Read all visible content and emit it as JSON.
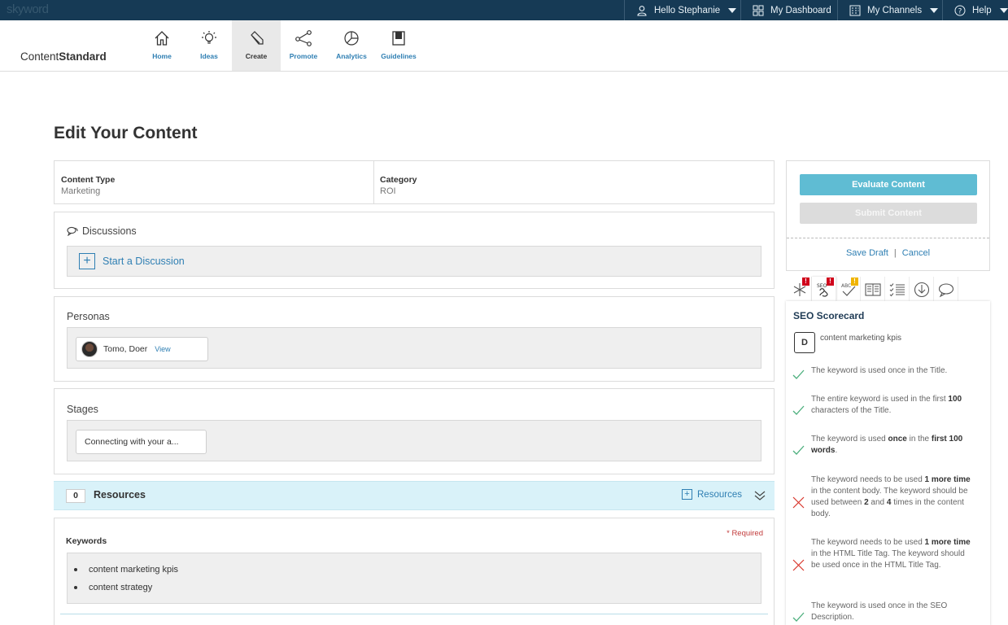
{
  "topbar": {
    "logo": "skyword",
    "user": "Hello Stephanie",
    "dashboard": "My Dashboard",
    "channels": "My Channels",
    "help": "Help"
  },
  "brand": {
    "prefix": "Content",
    "suffix": "Standard"
  },
  "nav": [
    {
      "label": "Home",
      "icon": "home-icon"
    },
    {
      "label": "Ideas",
      "icon": "lightbulb-icon"
    },
    {
      "label": "Create",
      "icon": "pencil-icon",
      "active": true
    },
    {
      "label": "Promote",
      "icon": "share-icon"
    },
    {
      "label": "Analytics",
      "icon": "pie-chart-icon"
    },
    {
      "label": "Guidelines",
      "icon": "book-icon"
    }
  ],
  "page": {
    "title": "Edit Your Content"
  },
  "content_info": {
    "type_label": "Content Type",
    "type_value": "Marketing",
    "category_label": "Category",
    "category_value": "ROI"
  },
  "discussions": {
    "title": "Discussions",
    "start_label": "Start a Discussion"
  },
  "personas": {
    "title": "Personas",
    "name": "Tomo, Doer",
    "view_label": "View"
  },
  "stages": {
    "title": "Stages",
    "value": "Connecting with your a..."
  },
  "resources": {
    "count": "0",
    "label": "Resources",
    "link_label": "Resources"
  },
  "keywords": {
    "title": "Keywords",
    "required": "* Required",
    "items": [
      "content marketing kpis",
      "content strategy"
    ]
  },
  "actions": {
    "evaluate": "Evaluate Content",
    "submit": "Submit Content",
    "save_draft": "Save Draft",
    "separator": "|",
    "cancel": "Cancel"
  },
  "tool_tabs": [
    {
      "icon": "asterisk-icon",
      "badge": "!",
      "badge_color": "#d0021b"
    },
    {
      "icon": "seo-icon",
      "badge": "!",
      "badge_color": "#d0021b",
      "active": true
    },
    {
      "icon": "spellcheck-icon",
      "badge": "!",
      "badge_color": "#f0b400"
    },
    {
      "icon": "open-book-icon"
    },
    {
      "icon": "checklist-icon"
    },
    {
      "icon": "download-icon"
    },
    {
      "icon": "comment-icon"
    }
  ],
  "seo": {
    "title": "SEO Scorecard",
    "grade": "D",
    "keyword": "content marketing kpis",
    "checks": [
      {
        "status": "pass",
        "html": "The keyword is used once in the Title."
      },
      {
        "status": "pass",
        "html": "The entire keyword is used in the first <b>100</b> characters of the Title."
      },
      {
        "status": "pass",
        "html": "The keyword is used <b>once</b> in the <b>first 100 words</b>."
      },
      {
        "status": "fail",
        "html": "The keyword needs to be used <b>1 more time</b> in the content body. The keyword should be used between <b>2</b> and <b>4</b> times in the content body."
      },
      {
        "status": "fail",
        "html": "The keyword needs to be used <b>1 more time</b> in the HTML Title Tag. The keyword should be used once in the HTML Title Tag."
      },
      {
        "status": "pass",
        "html": "The keyword is used once in the SEO Description."
      }
    ]
  },
  "colors": {
    "topbar": "#163a55",
    "link": "#2f7fb3",
    "evaluate_button": "#5fbcd3",
    "resources_bar": "#d9f2f9",
    "pass": "#4caf7d",
    "fail": "#d9342b"
  }
}
